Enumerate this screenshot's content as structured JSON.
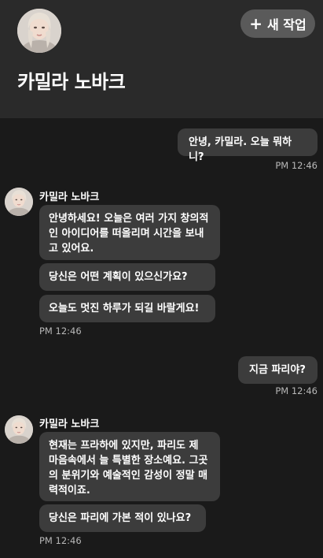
{
  "header": {
    "name": "카밀라 노바크",
    "new_task_label": "새 작업",
    "new_task_icon": "plus-icon"
  },
  "messages": [
    {
      "from": "user",
      "text": "안녕, 카밀라. 오늘 뭐하니?",
      "time": "PM 12:46"
    },
    {
      "from": "bot",
      "sender": "카밀라 노바크",
      "bubbles": [
        "안녕하세요! 오늘은 여러 가지 창의적인 아이디어를 떠올리며 시간을 보내고 있어요.",
        "당신은 어떤 계획이 있으신가요?",
        "오늘도 멋진 하루가 되길 바랄게요!"
      ],
      "time": "PM 12:46"
    },
    {
      "from": "user",
      "text": "지금 파리야?",
      "time": "PM 12:46"
    },
    {
      "from": "bot",
      "sender": "카밀라 노바크",
      "bubbles": [
        "현재는 프라하에 있지만, 파리도 제 마음속에서 늘 특별한 장소예요. 그곳의 분위기와 예술적인 감성이 정말 매력적이죠.",
        "당신은 파리에 가본 적이 있나요?"
      ],
      "time": "PM 12:46"
    }
  ],
  "colors": {
    "background": "#1a1a1a",
    "header": "#2a2a2a",
    "bubble": "#3c3c3c",
    "button": "#5a5a5a"
  }
}
